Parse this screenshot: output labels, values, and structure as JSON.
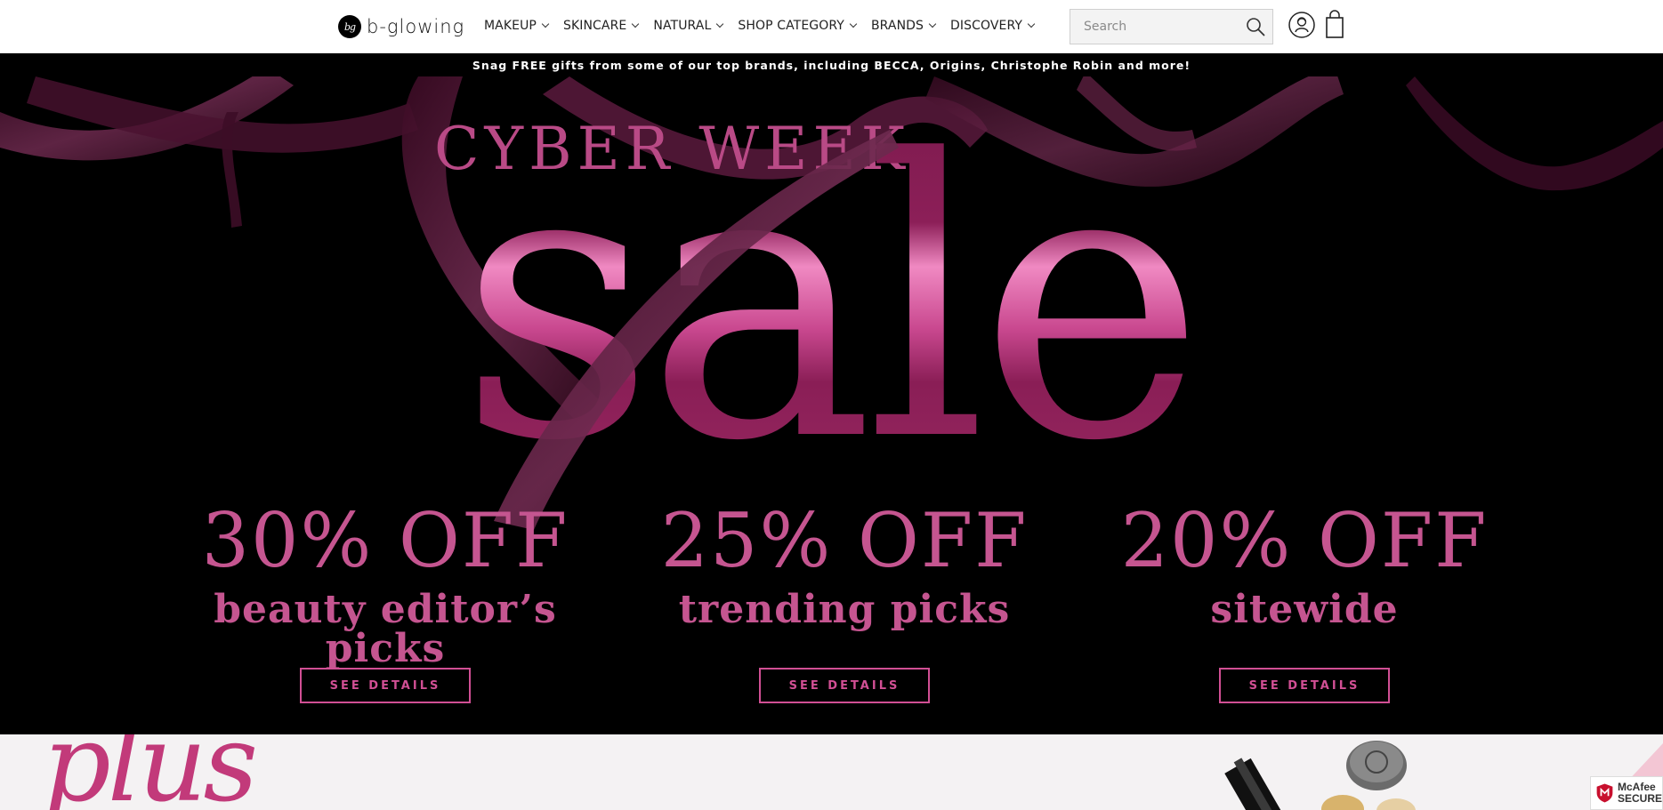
{
  "header": {
    "logo": {
      "mark": "bg",
      "text": "b-glowing"
    },
    "nav": [
      {
        "label": "MAKEUP"
      },
      {
        "label": "SKINCARE"
      },
      {
        "label": "NATURAL"
      },
      {
        "label": "SHOP CATEGORY"
      },
      {
        "label": "BRANDS"
      },
      {
        "label": "DISCOVERY"
      }
    ],
    "search": {
      "placeholder": "Search",
      "value": ""
    },
    "icons": {
      "search": "search-icon",
      "account": "account-icon",
      "cart": "shopping-bag-icon"
    }
  },
  "promo_bar": {
    "text": "Snag FREE gifts from some of our top brands, including BECCA, Origins, Christophe Robin and more!"
  },
  "hero": {
    "eyebrow": "CYBER WEEK",
    "headline": "sale",
    "offers": [
      {
        "percent": "30% OFF",
        "description": "beauty editor’s picks",
        "button": "SEE DETAILS"
      },
      {
        "percent": "25% OFF",
        "description": "trending picks",
        "button": "SEE DETAILS"
      },
      {
        "percent": "20% OFF",
        "description": "sitewide",
        "button": "SEE DETAILS"
      }
    ],
    "colors": {
      "background": "#000000",
      "accent": "#c55590",
      "button": "#d14f94"
    }
  },
  "plus_section": {
    "script_text": "plus"
  },
  "badge": {
    "line1": "McAfee",
    "line2": "SECURE"
  }
}
